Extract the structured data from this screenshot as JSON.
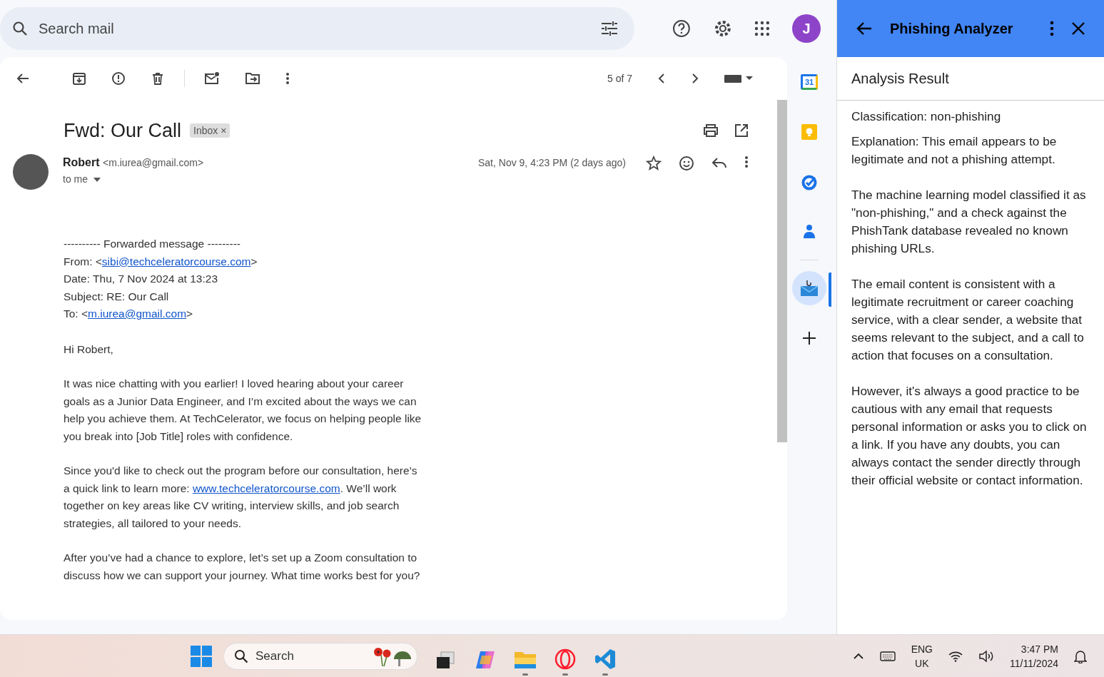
{
  "search": {
    "placeholder": "Search mail"
  },
  "account": {
    "initial": "J"
  },
  "toolbar": {
    "pager": "5 of 7"
  },
  "email": {
    "subject": "Fwd: Our Call",
    "label": "Inbox",
    "label_close": "×",
    "sender_name": "Robert",
    "sender_email": "<m.iurea@gmail.com>",
    "recipient": "to me",
    "date": "Sat, Nov 9, 4:23 PM (2 days ago)",
    "starred": false,
    "forward_header": [
      {
        "text": "---------- Forwarded message ---------"
      },
      {
        "text": "From: <",
        "link": "sibi@techceleratorcourse.com",
        "after": ">"
      },
      {
        "text": "Date: Thu, 7 Nov 2024 at 13:23"
      },
      {
        "text": "Subject: RE: Our Call"
      },
      {
        "text": "To: <",
        "link": "m.iurea@gmail.com",
        "after": ">"
      }
    ],
    "paragraphs": [
      {
        "text": "Hi Robert,"
      },
      {
        "text": "It was nice chatting with you earlier! I loved hearing about your career goals as a Junior Data Engineer, and I’m excited about the ways we can help you achieve them. At TechCelerator, we focus on helping people like you break into [Job Title] roles with confidence."
      },
      {
        "text": "Since you'd like to check out the program before our consultation, here’s a quick link to learn more: ",
        "link": "www.techceleratorcourse.com",
        "after": ". We’ll work together on key areas like CV writing, interview skills, and job search strategies, all tailored to your needs."
      },
      {
        "text": "After you’ve had a chance to explore, let’s set up a Zoom consultation to discuss how we can support your journey. What time works best for you?"
      }
    ]
  },
  "side_rail": {
    "calendar_day": "31",
    "items": [
      {
        "kind": "calendar",
        "selected": false
      },
      {
        "kind": "keep",
        "selected": false
      },
      {
        "kind": "tasks",
        "selected": false
      },
      {
        "kind": "contacts",
        "selected": false
      },
      {
        "kind": "divider"
      },
      {
        "kind": "addon",
        "selected": true
      },
      {
        "kind": "add",
        "selected": false
      }
    ]
  },
  "panel": {
    "title": "Phishing Analyzer",
    "heading": "Analysis Result",
    "paragraphs": [
      "Classification: non-phishing",
      "Explanation: This email appears to be legitimate and not a phishing attempt.",
      "The machine learning model classified it as \"non-phishing,\" and a check against the PhishTank database revealed no known phishing URLs.",
      "The email content is consistent with a legitimate recruitment or career coaching service, with a clear sender, a website that seems relevant to the subject, and a call to action that focuses on a consultation.",
      "However, it's always a good practice to be cautious with any email that requests personal information or asks you to click on a link. If you have any doubts, you can always contact the sender directly through their official website or contact information."
    ]
  },
  "taskbar": {
    "search_placeholder": "Search",
    "apps": [
      {
        "kind": "taskview",
        "running": false
      },
      {
        "kind": "copilot",
        "running": false
      },
      {
        "kind": "files",
        "running": true
      },
      {
        "kind": "opera",
        "running": true
      },
      {
        "kind": "vscode",
        "running": true
      }
    ],
    "language": "ENG",
    "region": "UK",
    "time": "3:47 PM",
    "date": "11/11/2024"
  }
}
